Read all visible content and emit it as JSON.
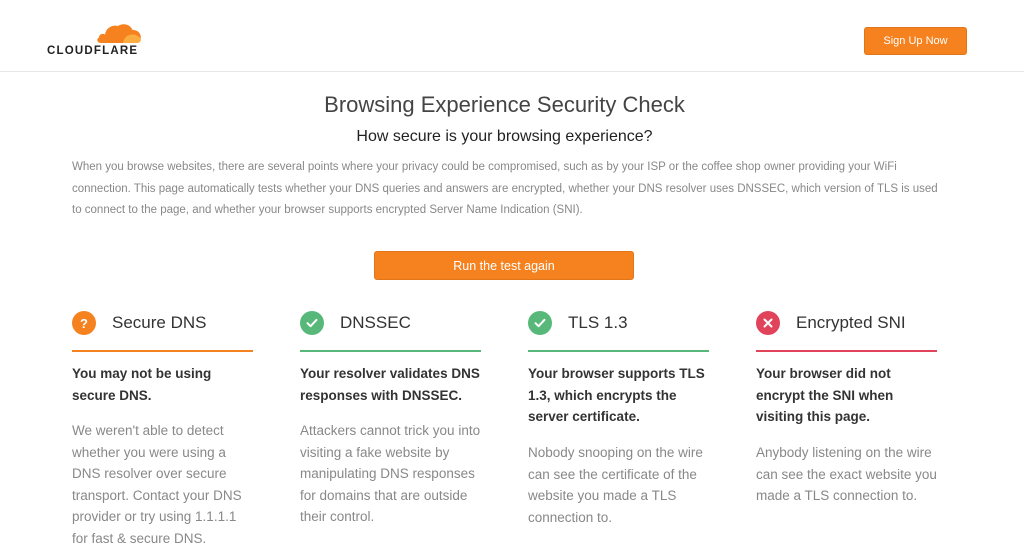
{
  "header": {
    "logo_text": "CLOUDFLARE",
    "signup_label": "Sign Up Now"
  },
  "main": {
    "title": "Browsing Experience Security Check",
    "subtitle": "How secure is your browsing experience?",
    "intro": "When you browse websites, there are several points where your privacy could be compromised, such as by your ISP or the coffee shop owner providing your WiFi connection. This page automatically tests whether your DNS queries and answers are encrypted, whether your DNS resolver uses DNSSEC, which version of TLS is used to connect to the page, and whether your browser supports encrypted Server Name Indication (SNI).",
    "run_button_label": "Run the test again"
  },
  "colors": {
    "accent": "#f6821f",
    "warning": "#f6821f",
    "success": "#58b87a",
    "failure": "#e0435a"
  },
  "cards": [
    {
      "status": "warning",
      "icon": "question-icon",
      "icon_glyph": "?",
      "title": "Secure DNS",
      "summary": "You may not be using secure DNS.",
      "detail": "We weren't able to detect whether you were using a DNS resolver over secure transport. Contact your DNS provider or try using 1.1.1.1 for fast & secure DNS."
    },
    {
      "status": "success",
      "icon": "checkmark-icon",
      "title": "DNSSEC",
      "summary": "Your resolver validates DNS responses with DNSSEC.",
      "detail": "Attackers cannot trick you into visiting a fake website by manipulating DNS responses for domains that are outside their control."
    },
    {
      "status": "success",
      "icon": "checkmark-icon",
      "title": "TLS 1.3",
      "summary": "Your browser supports TLS 1.3, which encrypts the server certificate.",
      "detail": "Nobody snooping on the wire can see the certificate of the website you made a TLS connection to."
    },
    {
      "status": "failure",
      "icon": "x-icon",
      "title": "Encrypted SNI",
      "summary": "Your browser did not encrypt the SNI when visiting this page.",
      "detail": "Anybody listening on the wire can see the exact website you made a TLS connection to."
    }
  ]
}
